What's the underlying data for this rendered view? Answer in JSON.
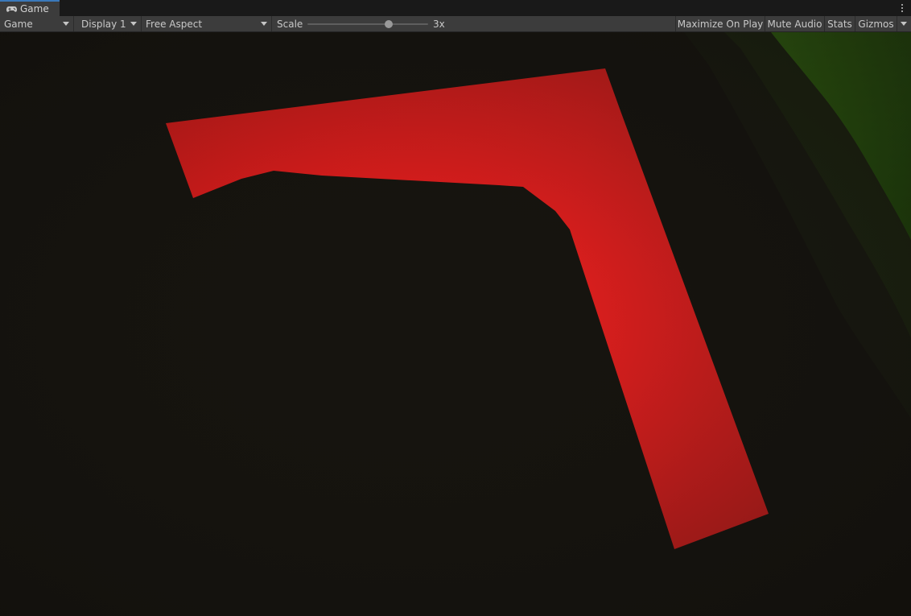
{
  "window": {
    "tab_title": "Game",
    "tab_icon": "gamepad-icon",
    "menu_icon": "kebab-menu-icon"
  },
  "toolbar": {
    "view_mode": "Game",
    "display": "Display 1",
    "aspect": "Free Aspect",
    "scale_label": "Scale",
    "scale_value": "3x",
    "scale_slider_fraction": 0.67,
    "maximize_on_play": "Maximize On Play",
    "mute_audio": "Mute Audio",
    "stats": "Stats",
    "gizmos": "Gizmos"
  },
  "scene": {
    "background_color": "#16140f",
    "shape_color": "#ff1e1e",
    "terrain_color": "#2e6a0c"
  }
}
